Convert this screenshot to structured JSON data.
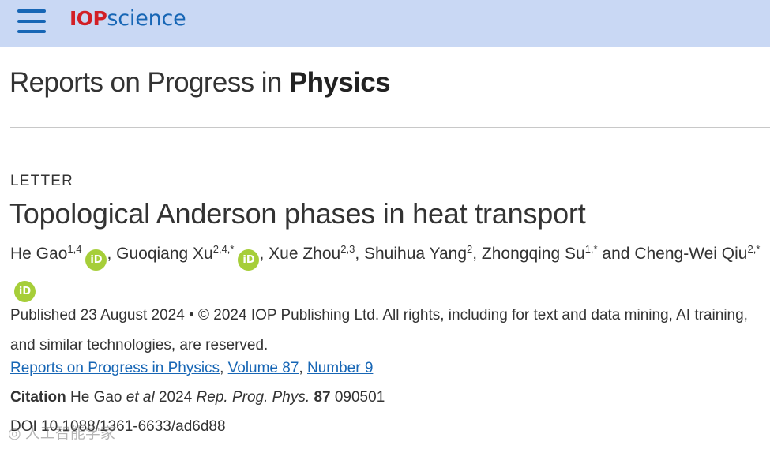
{
  "header": {
    "brand_iop": "IOP",
    "brand_science": "science",
    "menu_icon": "hamburger-menu-icon",
    "colors": {
      "bar": "#c9d8f4",
      "accent": "#1766b5",
      "brand_red": "#d21f26"
    }
  },
  "journal": {
    "title_regular": "Reports on Progress in ",
    "title_bold": "Physics"
  },
  "article": {
    "type": "LETTER",
    "title": "Topological Anderson phases in heat transport",
    "authors": [
      {
        "name": "He Gao",
        "affil": "1,4",
        "orcid": true,
        "sep": ", "
      },
      {
        "name": "Guoqiang Xu",
        "affil": "2,4,*",
        "orcid": true,
        "sep": ", "
      },
      {
        "name": "Xue Zhou",
        "affil": "2,3",
        "orcid": false,
        "sep": ", "
      },
      {
        "name": "Shuihua Yang",
        "affil": "2",
        "orcid": false,
        "sep": ", "
      },
      {
        "name": "Zhongqing Su",
        "affil": "1,*",
        "orcid": false,
        "sep": " and "
      },
      {
        "name": "Cheng-Wei Qiu",
        "affil": "2,*",
        "orcid": true,
        "sep": ""
      }
    ],
    "orcid_label": "iD",
    "published": "Published 23 August 2024 • © 2024 IOP Publishing Ltd. All rights, including for text and data mining, AI training, and similar technologies, are reserved.",
    "issue": {
      "journal_link": "Reports on Progress in Physics",
      "volume_link": "Volume 87",
      "number_link": "Number 9",
      "sep": ", "
    },
    "citation": {
      "label": "Citation",
      "author": "He Gao",
      "etal": "et al",
      "year": "2024",
      "journal": "Rep. Prog. Phys.",
      "volume": "87",
      "article_no": "090501"
    },
    "doi": "DOI 10.1088/1361-6633/ad6d88"
  },
  "watermark": "◎ 人工智能学家"
}
